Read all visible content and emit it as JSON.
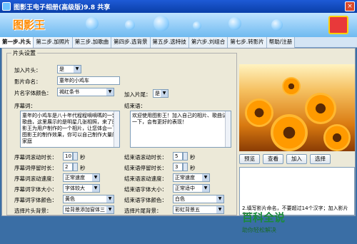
{
  "window": {
    "title": "图影王电子相册(高级版)9.8 共享",
    "close_label": "×"
  },
  "banner": {
    "logo": "图影王"
  },
  "tabs": [
    "第一步.片头",
    "第二步.加照片",
    "第三步.加歌曲",
    "第四步.选背景",
    "第五步.选特技",
    "第六步.刘组合",
    "第七步.转影片",
    "帮助/注册"
  ],
  "panel": {
    "group_title": "片头设置",
    "add_intro_label": "加入片头：",
    "add_intro_value": "是",
    "album_name_label": "影片命名：",
    "album_name_value": "童年的小鸡车",
    "name_color_label": "片名字体颜色：",
    "name_color_value": "褐红条书",
    "add_outro_label": "加入片尾：",
    "add_outro_value": "是",
    "intro_text_label": "序幕词：",
    "intro_text_value": "童年的小鸡车是八十年代程程嘀嘀嗎的一套歌曲，这里展示的是明星几张相照，来了图影王为用户制作的一个相片，让您体会一下图影王的制作效果，你可以自己制作大量的家庭",
    "outro_text_label": "结束语：",
    "outro_text_value": "欢迎使用图影王！加入自己的相片、歌曲试一下，会有更好的表现！",
    "intro_move_time_label": "序幕词滚动时长：",
    "intro_move_time_value": "10",
    "intro_stay_time_label": "序幕词停留时长：",
    "intro_stay_time_value": "2",
    "intro_speed_label": "序幕词滚动速度：",
    "intro_speed_value": "正常速度",
    "intro_size_label": "序幕词字体大小：",
    "intro_size_value": "字体较大",
    "intro_color_label": "序幕词字体颜色：",
    "intro_color_value": "黄色",
    "intro_bg_label": "选择片头背景：",
    "intro_bg_value": "给背景添加窗体三",
    "outro_move_time_label": "结束语滚动时长：",
    "outro_move_time_value": "5",
    "outro_stay_time_label": "结束语停留时长：",
    "outro_stay_time_value": "3",
    "outro_speed_label": "结束语滚动速度：",
    "outro_speed_value": "正常速度",
    "outro_size_label": "结束语字体大小：",
    "outro_size_value": "正常适中",
    "outro_color_label": "结束语字体颜色：",
    "outro_color_value": "白色",
    "outro_bg_label": "选择片尾背景：",
    "outro_bg_value": "彩虹背景五",
    "unit_seconds": "秒"
  },
  "preview": {
    "buttons": [
      "预览",
      "查看",
      "加入",
      "选择"
    ],
    "info": "2.填写影片命名，不要超过14个汉字；加入影片名字..."
  },
  "watermark": {
    "main": "百科全说",
    "sub": "助你轻松解决"
  }
}
